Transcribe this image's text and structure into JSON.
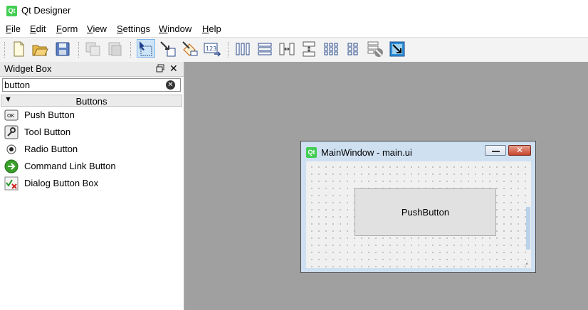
{
  "app": {
    "logo_text": "Qt",
    "title": "Qt Designer"
  },
  "menu": [
    {
      "label": "File",
      "accel": "F",
      "rest": "ile"
    },
    {
      "label": "Edit",
      "accel": "E",
      "rest": "dit"
    },
    {
      "label": "Form",
      "accel": "F",
      "pre": "",
      "rest": "orm"
    },
    {
      "label": "View",
      "accel": "V",
      "rest": "iew"
    },
    {
      "label": "Settings",
      "accel": "S",
      "rest": "ettings"
    },
    {
      "label": "Window",
      "accel": "W",
      "rest": "indow"
    },
    {
      "label": "Help",
      "accel": "H",
      "rest": "elp"
    }
  ],
  "toolbar": {
    "icons": [
      "new-file-icon",
      "open-folder-icon",
      "save-icon",
      "copy-icon",
      "paste-icon",
      "edit-widgets-icon",
      "edit-signals-slots-icon",
      "edit-buddies-icon",
      "edit-tab-order-icon",
      "layout-horizontal-icon",
      "layout-vertical-icon",
      "layout-h-splitter-icon",
      "layout-v-splitter-icon",
      "layout-grid-icon",
      "layout-form-icon",
      "break-layout-icon",
      "adjust-size-icon"
    ],
    "checked_icon": "edit-widgets-icon"
  },
  "widget_box": {
    "title": "Widget Box",
    "search_value": "button",
    "category": "Buttons",
    "items": [
      {
        "label": "Push Button",
        "icon": "push-button-icon",
        "icon_text": "OK"
      },
      {
        "label": "Tool Button",
        "icon": "tool-button-icon"
      },
      {
        "label": "Radio Button",
        "icon": "radio-button-icon"
      },
      {
        "label": "Command Link Button",
        "icon": "command-link-icon"
      },
      {
        "label": "Dialog Button Box",
        "icon": "dialog-button-box-icon"
      }
    ]
  },
  "form_window": {
    "logo_text": "Qt",
    "title": "MainWindow - main.ui",
    "push_button_label": "PushButton"
  },
  "colors": {
    "mdi_background": "#a0a0a0",
    "qt_green": "#41cd52",
    "form_frame": "#cfe0f1",
    "close_red": "#c7442b"
  }
}
